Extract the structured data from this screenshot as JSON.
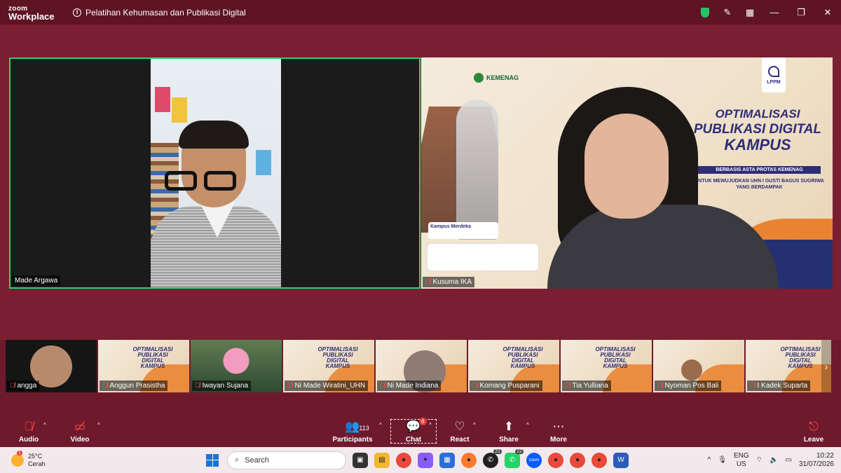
{
  "app": {
    "brand_line1": "zoom",
    "brand_line2": "Workplace",
    "meeting_title": "Pelatihan Kehumasan dan Publikasi Digital"
  },
  "main": {
    "tiles": [
      {
        "name": "Made Argawa",
        "muted": false
      },
      {
        "name": "Kusuma IKA",
        "muted": true
      }
    ],
    "slide": {
      "org": "KEMENAG",
      "title_line1": "OPTIMALISASI",
      "title_line2": "PUBLIKASI DIGITAL",
      "title_line3": "KAMPUS",
      "subtitle": "BERBASIS ASTA PROTAS KEMENAG",
      "tagline": "UNTUK MEWUJUDKAN UHN I GUSTI BAGUS SUGRIWA YANG BERDAMPAK",
      "lppm": "LPPM",
      "kampus": "Kampus Merdeka"
    }
  },
  "strip": {
    "thumbs": [
      {
        "name": "angga"
      },
      {
        "name": "Anggun Prasistha"
      },
      {
        "name": "Iwayan Sujana"
      },
      {
        "name": "Ni Made Wiratini_UHN"
      },
      {
        "name": "Ni Made Indiana"
      },
      {
        "name": "Komang Pusparani"
      },
      {
        "name": "Tia Yulliana"
      },
      {
        "name": "Nyoman Pos Bali"
      },
      {
        "name": "I Kadek Suparta"
      }
    ],
    "mini_title": "OPTIMALISASI PUBLIKASI DIGITAL KAMPUS"
  },
  "toolbar": {
    "audio": "Audio",
    "video": "Video",
    "participants": "Participants",
    "participants_count": "113",
    "chat": "Chat",
    "chat_badge": "6",
    "react": "React",
    "share": "Share",
    "more": "More",
    "leave": "Leave"
  },
  "taskbar": {
    "temp": "25°C",
    "weather": "Cerah",
    "weather_badge": "1",
    "search": "Search",
    "whatsapp_badge": "21",
    "app_badge": "22",
    "lang1": "ENG",
    "lang2": "US",
    "time": "10:22",
    "date": "31/07/2026"
  },
  "colors": {
    "accent_green": "#2ed16a",
    "background": "#6e1a2c",
    "muted_red": "#ff4b4b"
  }
}
